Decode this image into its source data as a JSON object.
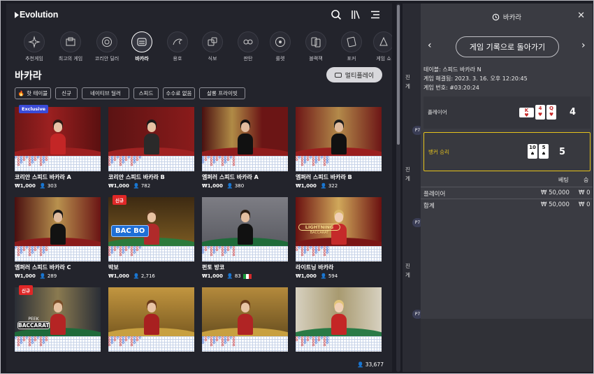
{
  "brand": "Evolution",
  "categories": [
    {
      "label": "추천게임",
      "icon": "sparkle-icon"
    },
    {
      "label": "최고의 게임",
      "icon": "trophy-icon"
    },
    {
      "label": "코리안 딜러",
      "icon": "chip-icon"
    },
    {
      "label": "바카라",
      "icon": "baccarat-icon"
    },
    {
      "label": "용호",
      "icon": "dragon-icon"
    },
    {
      "label": "식보",
      "icon": "dice-icon"
    },
    {
      "label": "판탄",
      "icon": "fantan-icon"
    },
    {
      "label": "룰렛",
      "icon": "roulette-icon"
    },
    {
      "label": "블랙잭",
      "icon": "blackjack-icon"
    },
    {
      "label": "포커",
      "icon": "poker-icon"
    },
    {
      "label": "게임 쇼",
      "icon": "gameshow-icon"
    }
  ],
  "section_title": "바카라",
  "multiplay_label": "멀티플레이",
  "filters": [
    "핫 테이블",
    "신규",
    "네이티브 딜러",
    "스피드",
    "수수료 없음",
    "살롱 프라이빗"
  ],
  "cards": [
    {
      "name": "코리안 스피드 바카라 A",
      "bet": "₩1,000",
      "players": "303",
      "badge": "Exclusive"
    },
    {
      "name": "코리안 스피드 바카라 B",
      "bet": "₩1,000",
      "players": "782",
      "badge": ""
    },
    {
      "name": "엠퍼러 스피드 바카라 A",
      "bet": "₩1,000",
      "players": "380",
      "badge": ""
    },
    {
      "name": "엠퍼러 스피드 바카라 B",
      "bet": "₩1,000",
      "players": "322",
      "badge": ""
    },
    {
      "name": "엠퍼러 스피드 바카라 C",
      "bet": "₩1,000",
      "players": "289",
      "badge": ""
    },
    {
      "name": "박보",
      "bet": "₩1,000",
      "players": "2,716",
      "badge": "신규"
    },
    {
      "name": "펀토 방코",
      "bet": "₩1,000",
      "players": "83",
      "badge": ""
    },
    {
      "name": "라이트닝 바카라",
      "bet": "₩1,000",
      "players": "594",
      "badge": ""
    },
    {
      "name": "",
      "bet": "",
      "players": "",
      "badge": "신규"
    },
    {
      "name": "",
      "bet": "",
      "players": "",
      "badge": ""
    },
    {
      "name": "",
      "bet": "",
      "players": "",
      "badge": ""
    },
    {
      "name": "",
      "bet": "",
      "players": "",
      "badge": ""
    }
  ],
  "thumb_text": {
    "bac_bo": "BAC BO",
    "lightning": "LIGHTNING",
    "lightning_sub": "BACCARAT",
    "peek": "PEEK",
    "peek_sub": "BACCARAT"
  },
  "total_players": "33,677",
  "behind_panel": [
    "진",
    "게",
    "P7",
    "진",
    "게",
    "P7",
    "진",
    "게",
    "P7"
  ],
  "panel": {
    "title": "바카라",
    "back_label": "게임 기록으로 돌아가기",
    "table_label": "테이블: 스피드 바카라 N",
    "settled": "게임 해결됨: 2023. 3. 16. 오후 12:20:45",
    "game_no": "게임 번호: #03:20:24",
    "player_label": "플레이어",
    "player_cards": [
      {
        "rank": "K",
        "suit": "♥",
        "side": true
      },
      {
        "rank": "4",
        "suit": "♥",
        "side": false
      },
      {
        "rank": "Q",
        "suit": "♥",
        "side": false
      }
    ],
    "player_score": "4",
    "banker_label": "뱅커 승리",
    "banker_cards": [
      {
        "rank": "10",
        "suit": "♠"
      },
      {
        "rank": "5",
        "suit": "♠"
      }
    ],
    "banker_score": "5",
    "col_bet": "베팅",
    "col_win": "승",
    "rows": [
      {
        "label": "플레이어",
        "bet": "₩ 50,000",
        "win": "₩ 0"
      },
      {
        "label": "합계",
        "bet": "₩ 50,000",
        "win": "₩ 0"
      }
    ]
  }
}
